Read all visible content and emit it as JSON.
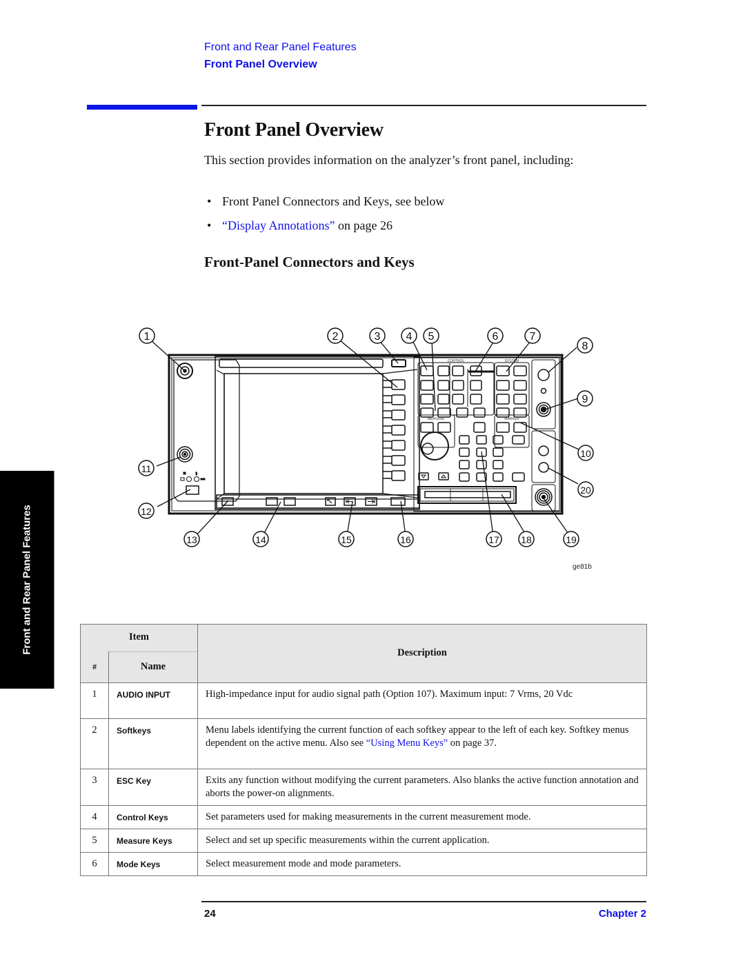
{
  "header": {
    "breadcrumb_chapter": "Front and Rear Panel Features",
    "breadcrumb_section": "Front Panel Overview"
  },
  "side_tab": {
    "label": "Front and Rear Panel Features"
  },
  "main": {
    "title": "Front Panel Overview",
    "intro": "This section provides information on the analyzer’s front panel, including:",
    "bullets": [
      {
        "text": "Front Panel Connectors and Keys, see below"
      },
      {
        "link": "“Display Annotations”",
        "suffix": " on page 26"
      }
    ],
    "subtitle": "Front-Panel Connectors and Keys"
  },
  "figure": {
    "id": "ge81b",
    "labels": {
      "control": "CONTROL",
      "system": "SYSTEM",
      "measure": "MEASURE",
      "marker": "MARKER"
    },
    "callouts": [
      "1",
      "2",
      "3",
      "4",
      "5",
      "6",
      "7",
      "8",
      "9",
      "10",
      "11",
      "12",
      "13",
      "14",
      "15",
      "16",
      "17",
      "18",
      "19",
      "20"
    ]
  },
  "table": {
    "header": {
      "item": "Item",
      "num": "#",
      "name": "Name",
      "description": "Description"
    },
    "rows": [
      {
        "num": "1",
        "name": "AUDIO INPUT",
        "desc": "High-impedance input for audio signal path (Option 107). Maximum input: 7 Vrms, 20 Vdc"
      },
      {
        "num": "2",
        "name": "Softkeys",
        "desc_pre": "Menu labels identifying the current function of each softkey appear to the left of each key. Softkey menus dependent on the active menu. Also see ",
        "desc_link": "“Using Menu Keys”",
        "desc_post": " on page 37."
      },
      {
        "num": "3",
        "name": "ESC Key",
        "desc": "Exits any function without modifying the current parameters. Also blanks the active function annotation and aborts the power-on alignments."
      },
      {
        "num": "4",
        "name": "Control Keys",
        "desc": "Set parameters used for making measurements in the current measurement mode."
      },
      {
        "num": "5",
        "name": "Measure Keys",
        "desc": "Select and set up specific measurements within the current application."
      },
      {
        "num": "6",
        "name": "Mode Keys",
        "desc": "Select measurement mode and mode parameters."
      }
    ]
  },
  "footer": {
    "page": "24",
    "chapter": "Chapter 2"
  },
  "colors": {
    "accent_blue": "#1010e8",
    "header_gray": "#e6e6e6"
  }
}
